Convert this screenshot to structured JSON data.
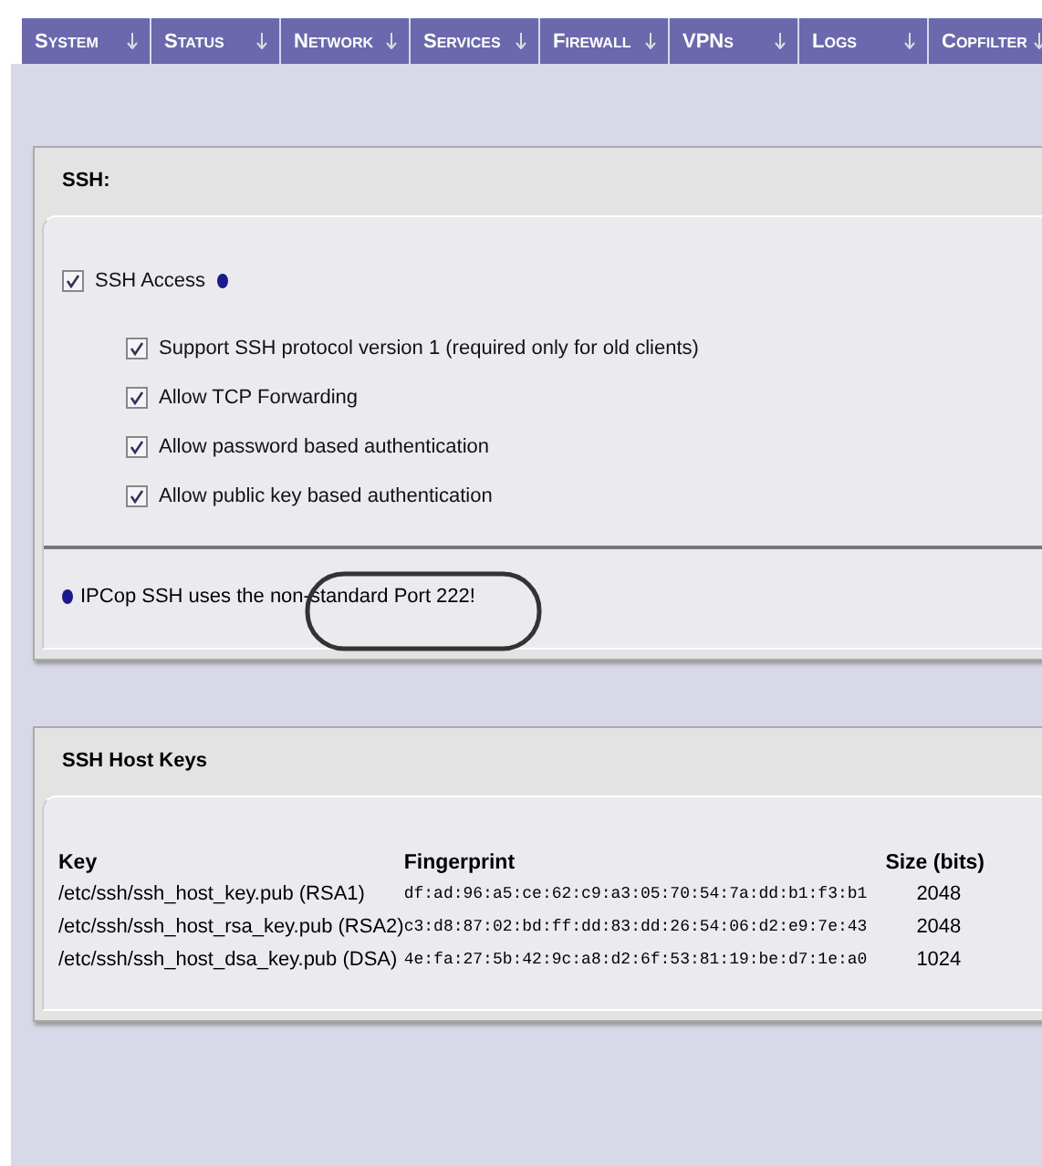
{
  "nav": [
    {
      "label": "System"
    },
    {
      "label": "Status"
    },
    {
      "label": "Network"
    },
    {
      "label": "Services"
    },
    {
      "label": "Firewall"
    },
    {
      "label": "VPNs"
    },
    {
      "label": "Logs"
    },
    {
      "label": "Copfilter"
    }
  ],
  "ssh": {
    "title": "SSH:",
    "access": {
      "label": "SSH Access",
      "checked": true
    },
    "options": [
      {
        "label": "Support SSH protocol version 1 (required only for old clients)",
        "checked": true
      },
      {
        "label": "Allow TCP Forwarding",
        "checked": true
      },
      {
        "label": "Allow password based authentication",
        "checked": true
      },
      {
        "label": "Allow public key based authentication",
        "checked": true
      }
    ],
    "note": "IPCop SSH uses the non-standard Port 222!"
  },
  "host_keys": {
    "title": "SSH Host Keys",
    "columns": [
      "Key",
      "Fingerprint",
      "Size (bits)"
    ],
    "rows": [
      [
        "/etc/ssh/ssh_host_key.pub (RSA1)",
        "df:ad:96:a5:ce:62:c9:a3:05:70:54:7a:dd:b1:f3:b1",
        "2048"
      ],
      [
        "/etc/ssh/ssh_host_rsa_key.pub (RSA2)",
        "c3:d8:87:02:bd:ff:dd:83:dd:26:54:06:d2:e9:7e:43",
        "2048"
      ],
      [
        "/etc/ssh/ssh_host_dsa_key.pub (DSA)",
        "4e:fa:27:5b:42:9c:a8:d2:6f:53:81:19:be:d7:1e:a0",
        "1024"
      ]
    ]
  }
}
